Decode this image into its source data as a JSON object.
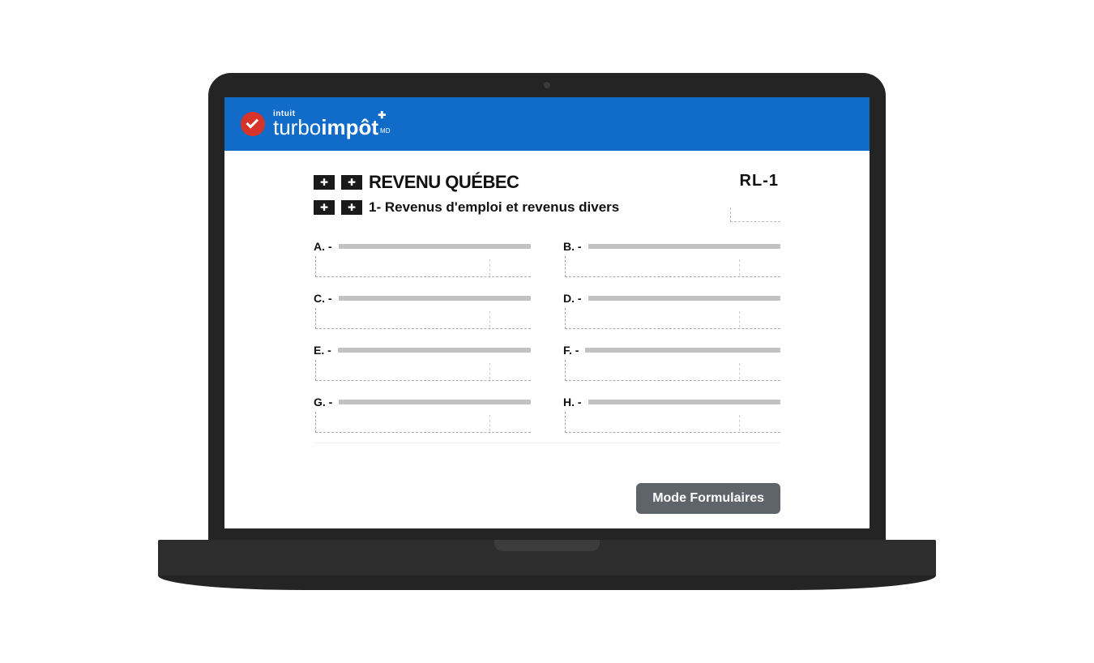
{
  "brand": {
    "parent": "intuit",
    "name_a": "turbo",
    "name_b": "impôt",
    "plus": "✚",
    "mark": "MD"
  },
  "form": {
    "agency": "REVENU QUÉBEC",
    "code": "RL-1",
    "section_title": "1- Revenus d'emploi et revenus divers",
    "fields": [
      {
        "letter": "A. -"
      },
      {
        "letter": "B. -"
      },
      {
        "letter": "C. -"
      },
      {
        "letter": "D. -"
      },
      {
        "letter": "E. -"
      },
      {
        "letter": "F. -"
      },
      {
        "letter": "G. -"
      },
      {
        "letter": "H. -"
      }
    ]
  },
  "footer": {
    "mode_button": "Mode Formulaires"
  }
}
